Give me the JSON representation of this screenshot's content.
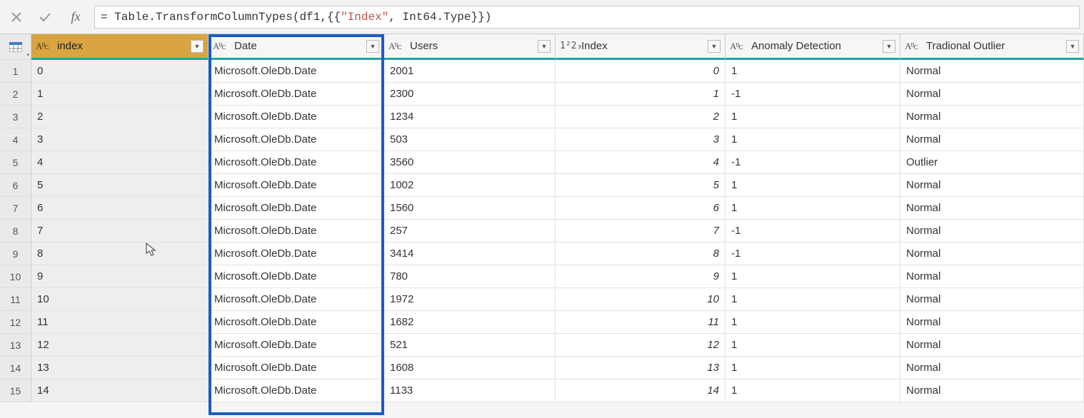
{
  "formula": {
    "prefix": "= ",
    "func": "Table.TransformColumnTypes",
    "open": "(",
    "arg0": "df1,",
    "braces_open": "{{",
    "col_name": "\"Index\"",
    "comma": ", ",
    "type": "Int64.Type",
    "braces_close": "}}",
    "close": ")"
  },
  "columns": {
    "indexL": {
      "label": "index",
      "type": "ABC"
    },
    "date": {
      "label": "Date",
      "type": "ABC"
    },
    "users": {
      "label": "Users",
      "type": "ABC"
    },
    "indexN": {
      "label": "Index",
      "type": "123"
    },
    "anom": {
      "label": "Anomaly Detection",
      "type": "ABC"
    },
    "trad": {
      "label": "Tradional Outlier",
      "type": "ABC"
    }
  },
  "type_abc": "Aᴮᴄ",
  "type_123": "1²2₃",
  "dropdown_glyph": "▼",
  "rows": [
    {
      "n": "1",
      "indexL": "0",
      "date": "Microsoft.OleDb.Date",
      "users": "2001",
      "indexN": "0",
      "anom": "1",
      "trad": "Normal"
    },
    {
      "n": "2",
      "indexL": "1",
      "date": "Microsoft.OleDb.Date",
      "users": "2300",
      "indexN": "1",
      "anom": "-1",
      "trad": "Normal"
    },
    {
      "n": "3",
      "indexL": "2",
      "date": "Microsoft.OleDb.Date",
      "users": "1234",
      "indexN": "2",
      "anom": "1",
      "trad": "Normal"
    },
    {
      "n": "4",
      "indexL": "3",
      "date": "Microsoft.OleDb.Date",
      "users": "503",
      "indexN": "3",
      "anom": "1",
      "trad": "Normal"
    },
    {
      "n": "5",
      "indexL": "4",
      "date": "Microsoft.OleDb.Date",
      "users": "3560",
      "indexN": "4",
      "anom": "-1",
      "trad": "Outlier"
    },
    {
      "n": "6",
      "indexL": "5",
      "date": "Microsoft.OleDb.Date",
      "users": "1002",
      "indexN": "5",
      "anom": "1",
      "trad": "Normal"
    },
    {
      "n": "7",
      "indexL": "6",
      "date": "Microsoft.OleDb.Date",
      "users": "1560",
      "indexN": "6",
      "anom": "1",
      "trad": "Normal"
    },
    {
      "n": "8",
      "indexL": "7",
      "date": "Microsoft.OleDb.Date",
      "users": "257",
      "indexN": "7",
      "anom": "-1",
      "trad": "Normal"
    },
    {
      "n": "9",
      "indexL": "8",
      "date": "Microsoft.OleDb.Date",
      "users": "3414",
      "indexN": "8",
      "anom": "-1",
      "trad": "Normal"
    },
    {
      "n": "10",
      "indexL": "9",
      "date": "Microsoft.OleDb.Date",
      "users": "780",
      "indexN": "9",
      "anom": "1",
      "trad": "Normal"
    },
    {
      "n": "11",
      "indexL": "10",
      "date": "Microsoft.OleDb.Date",
      "users": "1972",
      "indexN": "10",
      "anom": "1",
      "trad": "Normal"
    },
    {
      "n": "12",
      "indexL": "11",
      "date": "Microsoft.OleDb.Date",
      "users": "1682",
      "indexN": "11",
      "anom": "1",
      "trad": "Normal"
    },
    {
      "n": "13",
      "indexL": "12",
      "date": "Microsoft.OleDb.Date",
      "users": "521",
      "indexN": "12",
      "anom": "1",
      "trad": "Normal"
    },
    {
      "n": "14",
      "indexL": "13",
      "date": "Microsoft.OleDb.Date",
      "users": "1608",
      "indexN": "13",
      "anom": "1",
      "trad": "Normal"
    },
    {
      "n": "15",
      "indexL": "14",
      "date": "Microsoft.OleDb.Date",
      "users": "1133",
      "indexN": "14",
      "anom": "1",
      "trad": "Normal"
    }
  ]
}
